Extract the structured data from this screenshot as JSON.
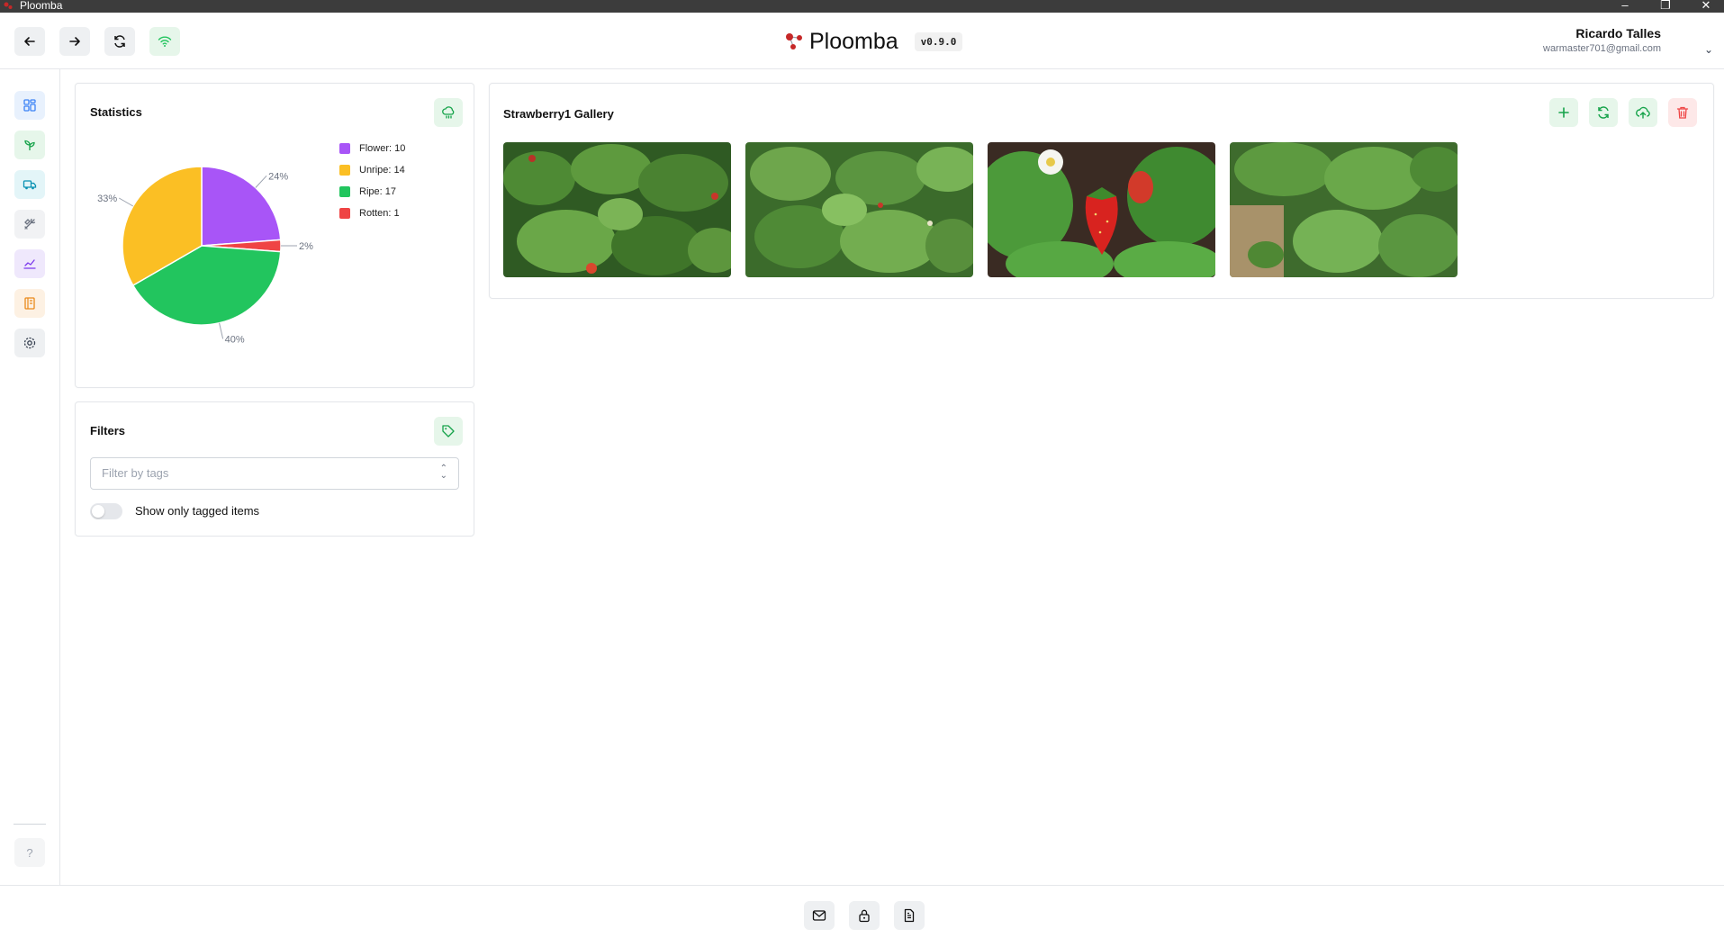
{
  "window": {
    "title": "Ploomba"
  },
  "header": {
    "brand": "Ploomba",
    "version": "v0.9.0",
    "user_name": "Ricardo Talles",
    "user_email": "warmaster701@gmail.com",
    "nav_icons": [
      "back-arrow-icon",
      "forward-arrow-icon",
      "refresh-icon",
      "wifi-icon"
    ]
  },
  "sidebar": {
    "items": [
      {
        "icon": "dashboard-icon",
        "color": "#3b82f6",
        "bg": "#e8f1fd"
      },
      {
        "icon": "plant-icon",
        "color": "#16a34a",
        "bg": "#e6f6ea"
      },
      {
        "icon": "truck-icon",
        "color": "#0891b2",
        "bg": "#e3f5f8"
      },
      {
        "icon": "tools-icon",
        "color": "#6b7280",
        "bg": "#f1f2f4"
      },
      {
        "icon": "chart-line-icon",
        "color": "#7c3aed",
        "bg": "#efe8fc"
      },
      {
        "icon": "notebook-icon",
        "color": "#ea8a1a",
        "bg": "#fdf1e3"
      },
      {
        "icon": "settings-icon",
        "color": "#374151",
        "bg": "#eef0f2"
      }
    ],
    "help_label": "?"
  },
  "statistics": {
    "title": "Statistics",
    "legend": [
      {
        "label": "Flower: 10",
        "color": "#a855f7"
      },
      {
        "label": "Unripe: 14",
        "color": "#fbbf24"
      },
      {
        "label": "Ripe: 17",
        "color": "#22c55e"
      },
      {
        "label": "Rotten: 1",
        "color": "#ef4444"
      }
    ]
  },
  "chart_data": {
    "type": "pie",
    "title": "",
    "categories": [
      "Flower",
      "Rotten",
      "Ripe",
      "Unripe"
    ],
    "values": [
      10,
      1,
      17,
      14
    ],
    "colors": [
      "#a855f7",
      "#ef4444",
      "#22c55e",
      "#fbbf24"
    ],
    "labels": [
      "24%",
      "2%",
      "40%",
      "33%"
    ],
    "legend_position": "right"
  },
  "filters": {
    "title": "Filters",
    "placeholder": "Filter by tags",
    "toggle_label": "Show only tagged items",
    "toggle_on": false
  },
  "gallery": {
    "title": "Strawberry1 Gallery",
    "actions": [
      "add-icon",
      "refresh-icon",
      "upload-cloud-icon",
      "trash-icon"
    ],
    "images": [
      "strawberry-plants-photo",
      "strawberry-plants-photo",
      "ripe-strawberry-photo",
      "strawberry-plants-photo"
    ]
  },
  "footer": {
    "icons": [
      "mail-icon",
      "lock-icon",
      "document-icon"
    ]
  }
}
